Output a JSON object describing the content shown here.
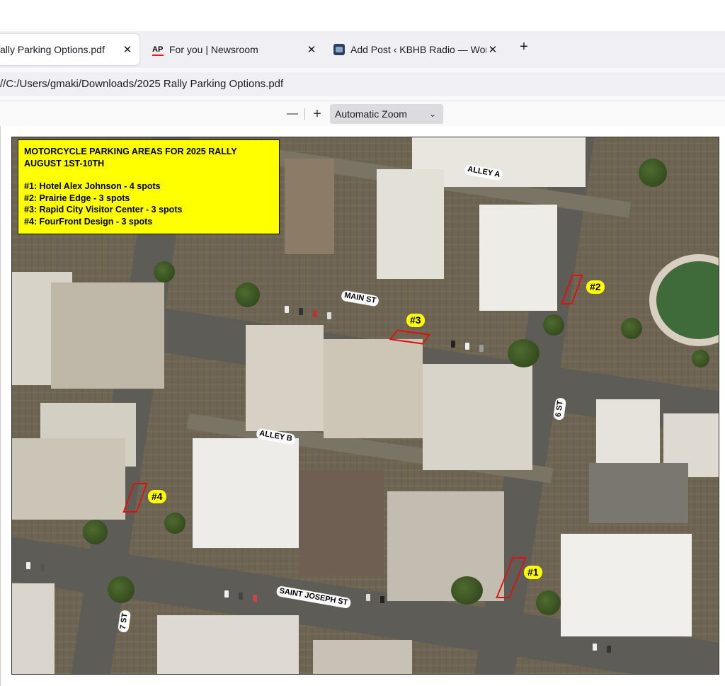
{
  "tabs": [
    {
      "title": "ally Parking Options.pdf",
      "close": "✕",
      "active": true
    },
    {
      "title": "For you | Newsroom",
      "close": "✕",
      "favicon": "AP"
    },
    {
      "title": "Add Post ‹ KBHB Radio — Word",
      "close": "✕",
      "favicon": "radio-station-icon"
    }
  ],
  "new_tab": "+",
  "url": "//C:/Users/gmaki/Downloads/2025 Rally Parking Options.pdf",
  "pdf_toolbar": {
    "zoom_out": "—",
    "zoom_in": "+",
    "zoom_value": "Automatic Zoom",
    "chevron": "⌄"
  },
  "legend": {
    "title_line1": "MOTORCYCLE PARKING AREAS FOR 2025 RALLY",
    "title_line2": "AUGUST 1ST-10TH",
    "items": [
      "#1: Hotel Alex Johnson - 4 spots",
      "#2: Prairie Edge - 3 spots",
      "#3: Rapid City Visitor Center - 3 spots",
      "#4: FourFront Design - 3 spots"
    ]
  },
  "streets": {
    "alley_a": "ALLEY A",
    "main_st": "MAIN ST",
    "alley_b": "ALLEY B",
    "six_st": "6 ST",
    "saint_joseph": "SAINT JOSEPH ST",
    "seven_st": "7 ST"
  },
  "markers": {
    "m1": "#1",
    "m2": "#2",
    "m3": "#3",
    "m4": "#4"
  },
  "colors": {
    "highlight": "#ffff00",
    "zone_outline": "#e01010"
  }
}
